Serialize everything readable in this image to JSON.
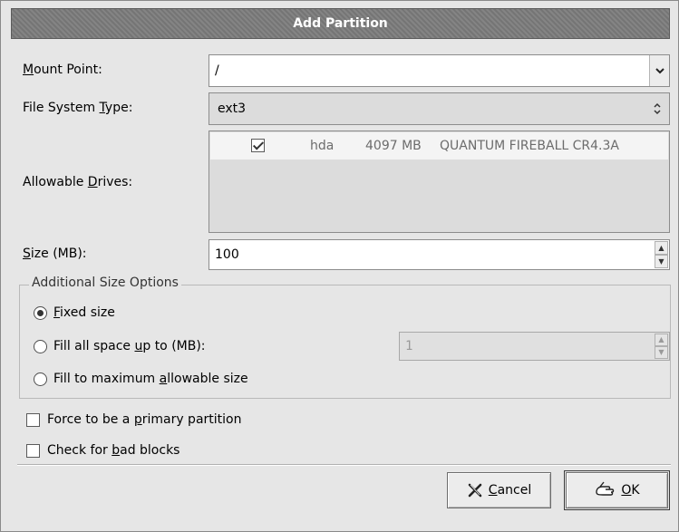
{
  "dialog": {
    "title": "Add Partition"
  },
  "mount_point": {
    "label_mnemonic": "M",
    "label_rest": "ount Point:",
    "value": "/"
  },
  "fs_type": {
    "label_pre": "File System ",
    "label_mnemonic": "T",
    "label_rest": "ype:",
    "value": "ext3"
  },
  "allowable_drives": {
    "label_pre": "Allowable ",
    "label_mnemonic": "D",
    "label_rest": "rives:",
    "drives": [
      {
        "checked": true,
        "name": "hda",
        "size": "4097 MB",
        "model": "QUANTUM FIREBALL CR4.3A"
      }
    ]
  },
  "size": {
    "label_mnemonic": "S",
    "label_rest": "ize (MB):",
    "value": "100"
  },
  "size_options": {
    "title": "Additional Size Options",
    "fixed": {
      "mnemonic": "F",
      "rest": "ixed size",
      "selected": true
    },
    "fill_upto": {
      "pre": "Fill all space ",
      "mnemonic": "u",
      "rest": "p to (MB):",
      "selected": false,
      "value": "1"
    },
    "fill_max": {
      "pre": "Fill to maximum ",
      "mnemonic": "a",
      "rest": "llowable size",
      "selected": false
    }
  },
  "force_primary": {
    "pre": "Force to be a ",
    "mnemonic": "p",
    "rest": "rimary partition",
    "checked": false
  },
  "bad_blocks": {
    "pre": "Check for ",
    "mnemonic": "b",
    "rest": "ad blocks",
    "checked": false
  },
  "buttons": {
    "cancel": {
      "mnemonic": "C",
      "rest": "ancel",
      "icon": "cancel-x-icon"
    },
    "ok": {
      "mnemonic": "O",
      "rest": "K",
      "icon": "ok-hand-icon"
    }
  }
}
